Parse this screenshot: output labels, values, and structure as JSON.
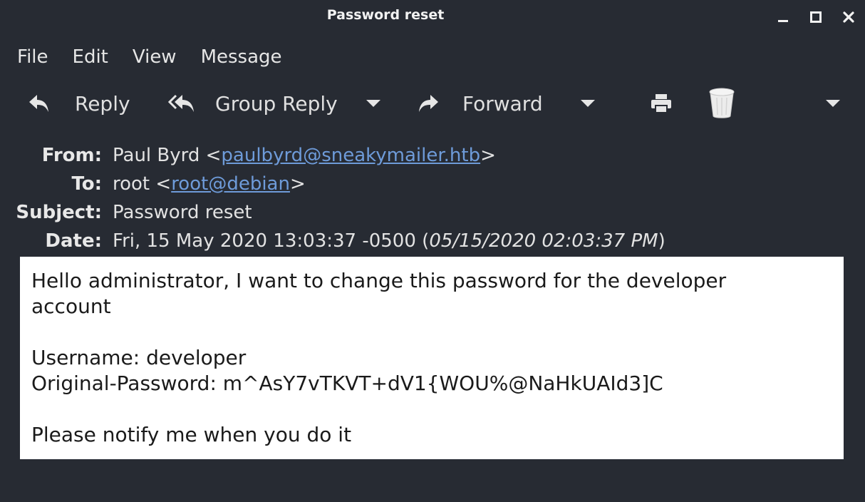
{
  "window": {
    "title": "Password reset",
    "controls": {
      "minimize": "minimize-icon",
      "maximize": "maximize-icon",
      "close": "close-icon"
    }
  },
  "menu": [
    "File",
    "Edit",
    "View",
    "Message"
  ],
  "toolbar": {
    "reply_label": "Reply",
    "group_reply_label": "Group Reply",
    "forward_label": "Forward",
    "icons": {
      "reply": "reply-icon",
      "group_reply": "reply-all-icon",
      "forward": "forward-icon",
      "print": "printer-icon",
      "delete": "trash-icon"
    }
  },
  "headers": {
    "from_label": "From:",
    "from_name": "Paul Byrd <",
    "from_email": "paulbyrd@sneakymailer.htb",
    "from_end": ">",
    "to_label": "To:",
    "to_name": "root <",
    "to_email": "root@debian",
    "to_end": ">",
    "subject_label": "Subject:",
    "subject": "Password reset",
    "date_label": "Date:",
    "date": "Fri, 15 May 2020 13:03:37 -0500 (",
    "date_local": "05/15/2020 02:03:37 PM",
    "date_end": ")"
  },
  "body": {
    "lines": [
      "Hello administrator, I want to change this password for the developer",
      "account",
      "",
      "Username: developer",
      "Original-Password: m^AsY7vTKVT+dV1{WOU%@NaHkUAId3]C",
      "",
      "Please notify me when you do it"
    ]
  },
  "colors": {
    "window_bg": "#272b33",
    "link": "#6e9bd9",
    "body_bg": "#ffffff"
  }
}
